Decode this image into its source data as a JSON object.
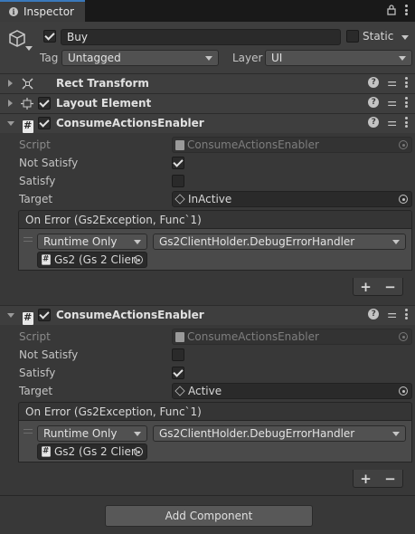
{
  "tab": {
    "title": "Inspector",
    "info_glyph": "i",
    "lock_icon": "lock-icon",
    "menu_icon": "kebab-menu-icon"
  },
  "gameobject": {
    "name": "Buy",
    "active": true,
    "static_label": "Static",
    "static_checked": false,
    "tag_label": "Tag",
    "tag_value": "Untagged",
    "layer_label": "Layer",
    "layer_value": "UI"
  },
  "components": {
    "rect_transform": {
      "title": "Rect Transform",
      "expanded": false
    },
    "layout_element": {
      "title": "Layout Element",
      "expanded": false,
      "enabled": true
    },
    "enabler1": {
      "title": "ConsumeActionsEnabler",
      "enabled": true,
      "script_label": "Script",
      "script_value": "ConsumeActionsEnabler",
      "not_satisfy_label": "Not Satisfy",
      "not_satisfy_checked": true,
      "satisfy_label": "Satisfy",
      "satisfy_checked": false,
      "target_label": "Target",
      "target_value": "InActive",
      "event_title": "On Error (Gs2Exception, Func`1)",
      "runtime_value": "Runtime Only",
      "handler_value": "Gs2ClientHolder.DebugErrorHandler",
      "object_value": "Gs2 (Gs 2 Clien",
      "plus": "+",
      "minus": "−"
    },
    "enabler2": {
      "title": "ConsumeActionsEnabler",
      "enabled": true,
      "script_label": "Script",
      "script_value": "ConsumeActionsEnabler",
      "not_satisfy_label": "Not Satisfy",
      "not_satisfy_checked": false,
      "satisfy_label": "Satisfy",
      "satisfy_checked": true,
      "target_label": "Target",
      "target_value": "Active",
      "event_title": "On Error (Gs2Exception, Func`1)",
      "runtime_value": "Runtime Only",
      "handler_value": "Gs2ClientHolder.DebugErrorHandler",
      "object_value": "Gs2 (Gs 2 Clien",
      "plus": "+",
      "minus": "−"
    }
  },
  "add_component_label": "Add Component",
  "colors": {
    "background": "#383838",
    "header": "#3e3e3e",
    "tab_accent": "#3a79bb"
  }
}
